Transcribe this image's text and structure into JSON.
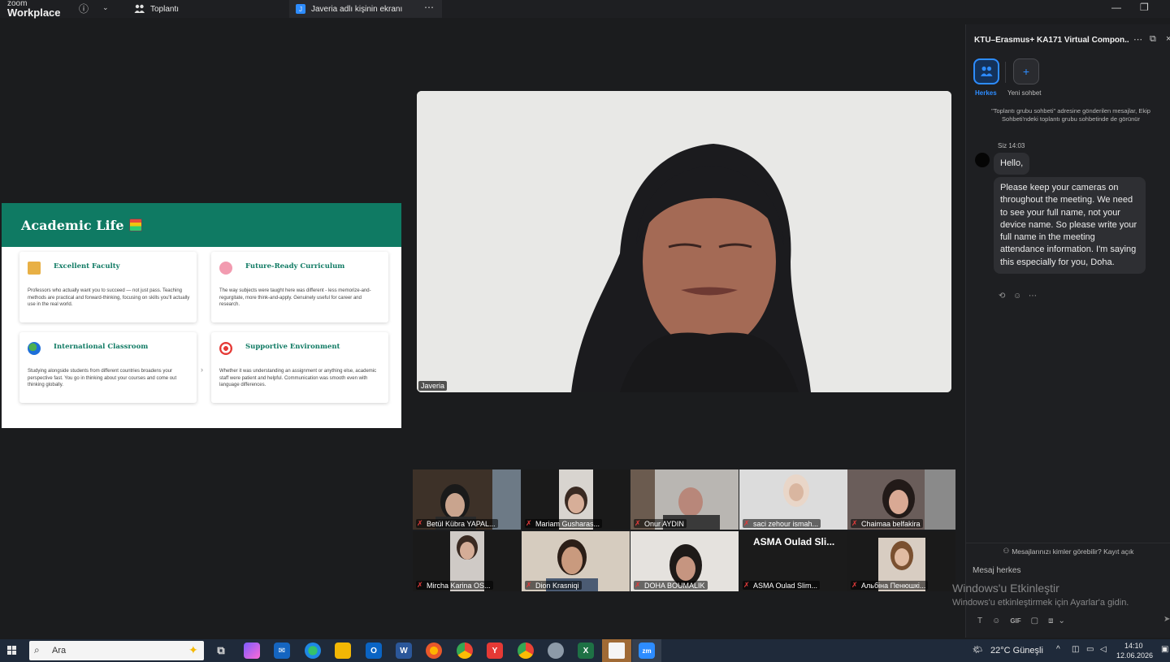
{
  "titlebar": {
    "brand_line1": "zoom",
    "brand_line2": "Workplace",
    "tab_meeting": "Toplantı",
    "tab_share_initial": "J",
    "tab_share": "Javeria adlı kişinin ekranı"
  },
  "slide": {
    "title": "Academic Life",
    "cards": [
      {
        "title": "Excellent Faculty",
        "text": "Professors who actually want you to succeed — not just pass. Teaching methods are practical and forward-thinking, focusing on skills you'll actually use in the real world."
      },
      {
        "title": "Future-Ready Curriculum",
        "text": "The way subjects were taught here was different - less memorize-and-regurgitate, more think-and-apply. Genuinely useful for career and research."
      },
      {
        "title": "International Classroom",
        "text": "Studying alongside students from different countries broadens your perspective fast. You go in thinking about your courses and come out thinking globally."
      },
      {
        "title": "Supportive Environment",
        "text": "Whether it was understanding an assignment or anything else, academic staff were patient and helpful. Communication was smooth even with language differences."
      }
    ]
  },
  "main_video": {
    "name": "Javeria"
  },
  "participants": [
    {
      "name": "Betül Kübra YAPAL..."
    },
    {
      "name": "Mariam Gusharas..."
    },
    {
      "name": "Onur AYDIN"
    },
    {
      "name": "saci zehour ismah..."
    },
    {
      "name": "Chaimaa belfakira"
    },
    {
      "name": "Mircha Karina OS..."
    },
    {
      "name": "Dion Krasniqi"
    },
    {
      "name": "DOHA BOUMALIK"
    },
    {
      "name": "ASMA Oulad Slim...",
      "display_text": "ASMA Oulad Sli..."
    },
    {
      "name": "Альбіна Пенюшкі..."
    }
  ],
  "chat": {
    "title": "KTU–Erasmus+ KA171 Virtual Compon...",
    "everyone_label": "Herkes",
    "new_chat_label": "Yeni sohbet",
    "notice": "\"Toplantı grubu sohbeti\" adresine gönderilen mesajlar, Ekip Sohbeti'ndeki toplantı grubu sohbetinde de görünür",
    "sender": "Siz 14:03",
    "messages": [
      "Hello,",
      "Please keep your cameras on throughout the meeting. We need to see your full name, not your device name. So please write your full name in the meeting attendance information. I'm saying this especially for you, Doha."
    ],
    "visibility": "Mesajlarınızı kimler görebilir? Kayıt açık",
    "input_placeholder": "Mesaj herkes",
    "gif_label": "GIF"
  },
  "watermark": {
    "line1": "Windows'u Etkinleştir",
    "line2": "Windows'u etkinleştirmek için Ayarlar'a gidin."
  },
  "taskbar": {
    "search_placeholder": "Ara",
    "weather": "22°C  Güneşli",
    "time": "14:10",
    "date": "12.06.2026",
    "zoom_app": "zm"
  }
}
